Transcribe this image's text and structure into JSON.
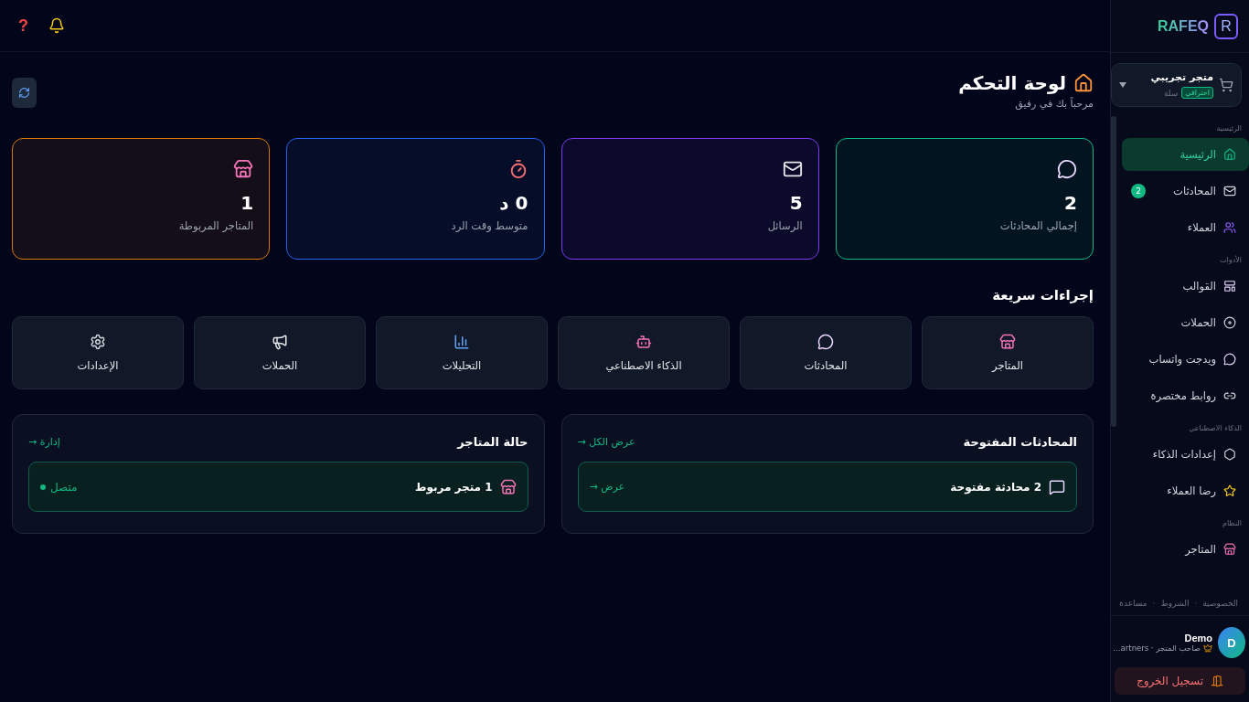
{
  "topbar": {
    "help": "?"
  },
  "sidebar": {
    "logo": "RAFEQ",
    "logo_mark": "R",
    "store": {
      "name": "متجر تجريبي",
      "badge": "احترافي",
      "platform": "سلة"
    },
    "sections": [
      {
        "label": "الرئيسية",
        "items": [
          {
            "label": "الرئيسية",
            "selected": true
          },
          {
            "label": "المحادثات",
            "selected": false,
            "badge": "2"
          },
          {
            "label": "العملاء",
            "selected": false
          }
        ]
      },
      {
        "label": "الأدوات",
        "items": [
          {
            "label": "القوالب",
            "selected": false
          },
          {
            "label": "الحملات",
            "selected": false
          },
          {
            "label": "ويدجت واتساب",
            "selected": false
          },
          {
            "label": "روابط مختصرة",
            "selected": false
          }
        ]
      },
      {
        "label": "الذكاء الاصطناعي",
        "items": [
          {
            "label": "إعدادات الذكاء",
            "selected": false
          },
          {
            "label": "رضا العملاء",
            "selected": false
          }
        ]
      },
      {
        "label": "النظام",
        "items": [
          {
            "label": "المتاجر",
            "selected": false
          }
        ]
      }
    ],
    "footer_links": [
      "الخصوصية",
      "الشروط",
      "مساعدة"
    ],
    "footer_separator": "·",
    "user": {
      "initial": "D",
      "name": "Demo",
      "role": "صاحب المتجر · artners…"
    },
    "logout": "تسجيل الخروج"
  },
  "header": {
    "title": "لوحة التحكم",
    "subtitle": "مرحباً بك في رفيق"
  },
  "stats": [
    {
      "value": "2",
      "label": "إجمالي المحادثات",
      "color": "#10b981"
    },
    {
      "value": "5",
      "label": "الرسائل",
      "color": "#7c3aed"
    },
    {
      "value": "0 د",
      "label": "متوسط وقت الرد",
      "color": "#2563eb"
    },
    {
      "value": "1",
      "label": "المتاجر المربوطة",
      "color": "#d97706"
    }
  ],
  "quick_actions": {
    "title": "إجراءات سريعة",
    "items": [
      "المتاجر",
      "المحادثات",
      "الذكاء الاصطناعي",
      "التحليلات",
      "الحملات",
      "الإعدادات"
    ]
  },
  "panels": [
    {
      "title": "المحادثات المفتوحة",
      "link": "عرض الكل →",
      "row_text": "2 محادثة مفتوحة",
      "row_action": "عرض →"
    },
    {
      "title": "حالة المتاجر",
      "link": "إدارة →",
      "row_text": "1 متجر مربوط",
      "row_status": "متصل"
    }
  ]
}
